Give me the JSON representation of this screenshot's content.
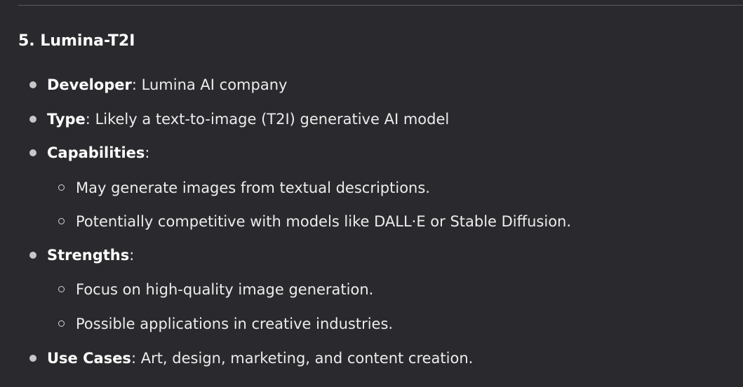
{
  "section": {
    "heading": "5. Lumina-T2I",
    "items": [
      {
        "term": "Developer",
        "sep": ": ",
        "text": "Lumina AI company"
      },
      {
        "term": "Type",
        "sep": ": ",
        "text": "Likely a text-to-image (T2I) generative AI model"
      },
      {
        "term": "Capabilities",
        "sep": ":",
        "text": "",
        "sub": [
          "May generate images from textual descriptions.",
          "Potentially competitive with models like DALL·E or Stable Diffusion."
        ]
      },
      {
        "term": "Strengths",
        "sep": ":",
        "text": "",
        "sub": [
          "Focus on high-quality image generation.",
          "Possible applications in creative industries."
        ]
      },
      {
        "term": "Use Cases",
        "sep": ": ",
        "text": "Art, design, marketing, and content creation."
      }
    ]
  }
}
